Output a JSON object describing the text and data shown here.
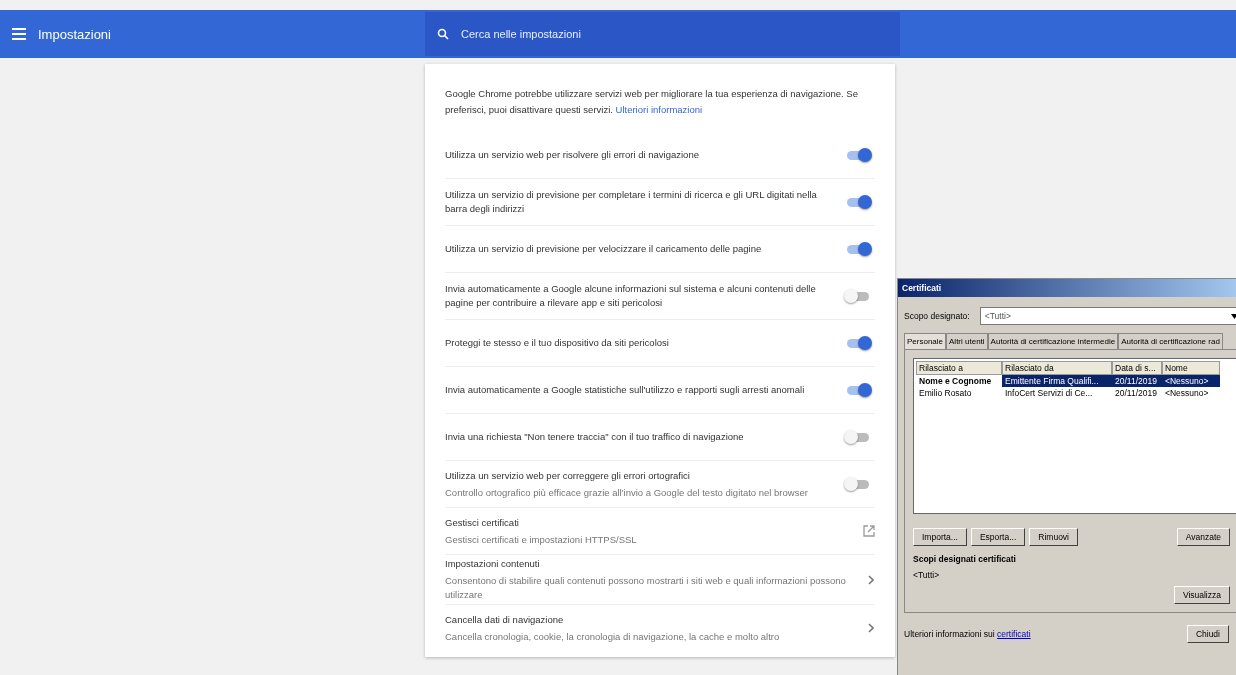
{
  "header": {
    "title": "Impostazioni",
    "search": {
      "placeholder": "Cerca nelle impostazioni"
    }
  },
  "intro": {
    "text": "Google Chrome potrebbe utilizzare servizi web per migliorare la tua esperienza di navigazione. Se preferisci, puoi disattivare questi servizi.",
    "link": "Ulteriori informazioni"
  },
  "settings": [
    {
      "kind": "toggle",
      "label": "Utilizza un servizio web per risolvere gli errori di navigazione",
      "on": true
    },
    {
      "kind": "toggle",
      "label": "Utilizza un servizio di previsione per completare i termini di ricerca e gli URL digitati nella barra degli indirizzi",
      "on": true
    },
    {
      "kind": "toggle",
      "label": "Utilizza un servizio di previsione per velocizzare il caricamento delle pagine",
      "on": true
    },
    {
      "kind": "toggle",
      "label": "Invia automaticamente a Google alcune informazioni sul sistema e alcuni contenuti delle pagine per contribuire a rilevare app e siti pericolosi",
      "on": false
    },
    {
      "kind": "toggle",
      "label": "Proteggi te stesso e il tuo dispositivo da siti pericolosi",
      "on": true
    },
    {
      "kind": "toggle",
      "label": "Invia automaticamente a Google statistiche sull'utilizzo e rapporti sugli arresti anomali",
      "on": true
    },
    {
      "kind": "toggle",
      "label": "Invia una richiesta \"Non tenere traccia\" con il tuo traffico di navigazione",
      "on": false
    },
    {
      "kind": "toggle",
      "label": "Utilizza un servizio web per correggere gli errori ortografici",
      "sublabel": "Controllo ortografico più efficace grazie all'invio a Google del testo digitato nel browser",
      "on": false
    },
    {
      "kind": "external",
      "label": "Gestisci certificati",
      "sublabel": "Gestisci certificati e impostazioni HTTPS/SSL"
    },
    {
      "kind": "arrow",
      "label": "Impostazioni contenuti",
      "sublabel": "Consentono di stabilire quali contenuti possono mostrarti i siti web e quali informazioni possono utilizzare"
    },
    {
      "kind": "arrow",
      "label": "Cancella dati di navigazione",
      "sublabel": "Cancella cronologia, cookie, la cronologia di navigazione, la cache e molto altro"
    }
  ],
  "dialog": {
    "title": "Certificati",
    "purpose_label": "Scopo designato:",
    "purpose_value": "<Tutti>",
    "tabs": [
      {
        "label": "Personale",
        "selected": true
      },
      {
        "label": "Altri utenti",
        "selected": false
      },
      {
        "label": "Autorità di certificazione intermedie",
        "selected": false
      },
      {
        "label": "Autorità di certificazione rad",
        "selected": false
      }
    ],
    "columns": [
      "Rilasciato a",
      "Rilasciato da",
      "Data di s...",
      "Nome"
    ],
    "rows": [
      {
        "cells": [
          "Nome e Cognome",
          "Emittente Firma Qualifi...",
          "20/11/2019",
          "<Nessuno>"
        ],
        "selected": true
      },
      {
        "cells": [
          "Emilio Rosato",
          "InfoCert Servizi di Ce...",
          "20/11/2019",
          "<Nessuno>"
        ],
        "selected": false
      }
    ],
    "buttons": [
      "Importa...",
      "Esporta...",
      "Rimuovi"
    ],
    "advanced_button": "Avanzate",
    "purposes_label": "Scopi designati certificati",
    "purposes_value": "<Tutti>",
    "view_button": "Visualizza",
    "footer_text": "Ulteriori informazioni sui",
    "footer_link": "certificati",
    "close_button": "Chiudi"
  }
}
